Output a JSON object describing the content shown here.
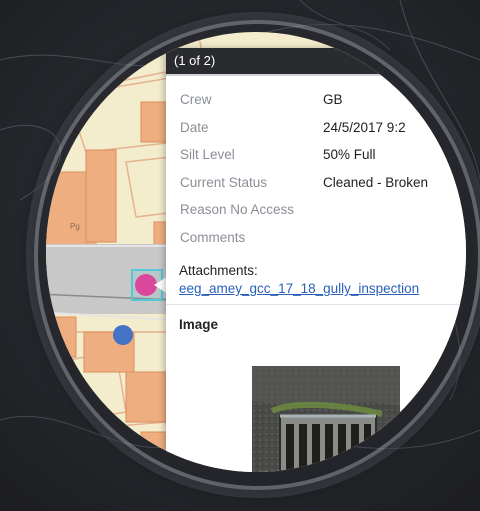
{
  "popup": {
    "header": "(1 of 2)",
    "attributes": [
      {
        "key": "Crew",
        "value": "GB"
      },
      {
        "key": "Date",
        "value": "24/5/2017 9:2"
      },
      {
        "key": "Silt Level",
        "value": "50% Full"
      },
      {
        "key": "Current Status",
        "value": "Cleaned - Broken"
      },
      {
        "key": "Reason No Access",
        "value": ""
      },
      {
        "key": "Comments",
        "value": ""
      }
    ],
    "attachments_label": "Attachments:",
    "attachment_link": "eeg_amey_gcc_17_18_gully_inspection",
    "image_title": "Image"
  },
  "map": {
    "parcel_label": "Pg",
    "colors": {
      "background": "#f3eccd",
      "building": "#efae80",
      "road": "#c8c8c8",
      "selected_point": "#d9489a",
      "other_point": "#4472c4",
      "selection_box": "#55c8d8"
    }
  }
}
